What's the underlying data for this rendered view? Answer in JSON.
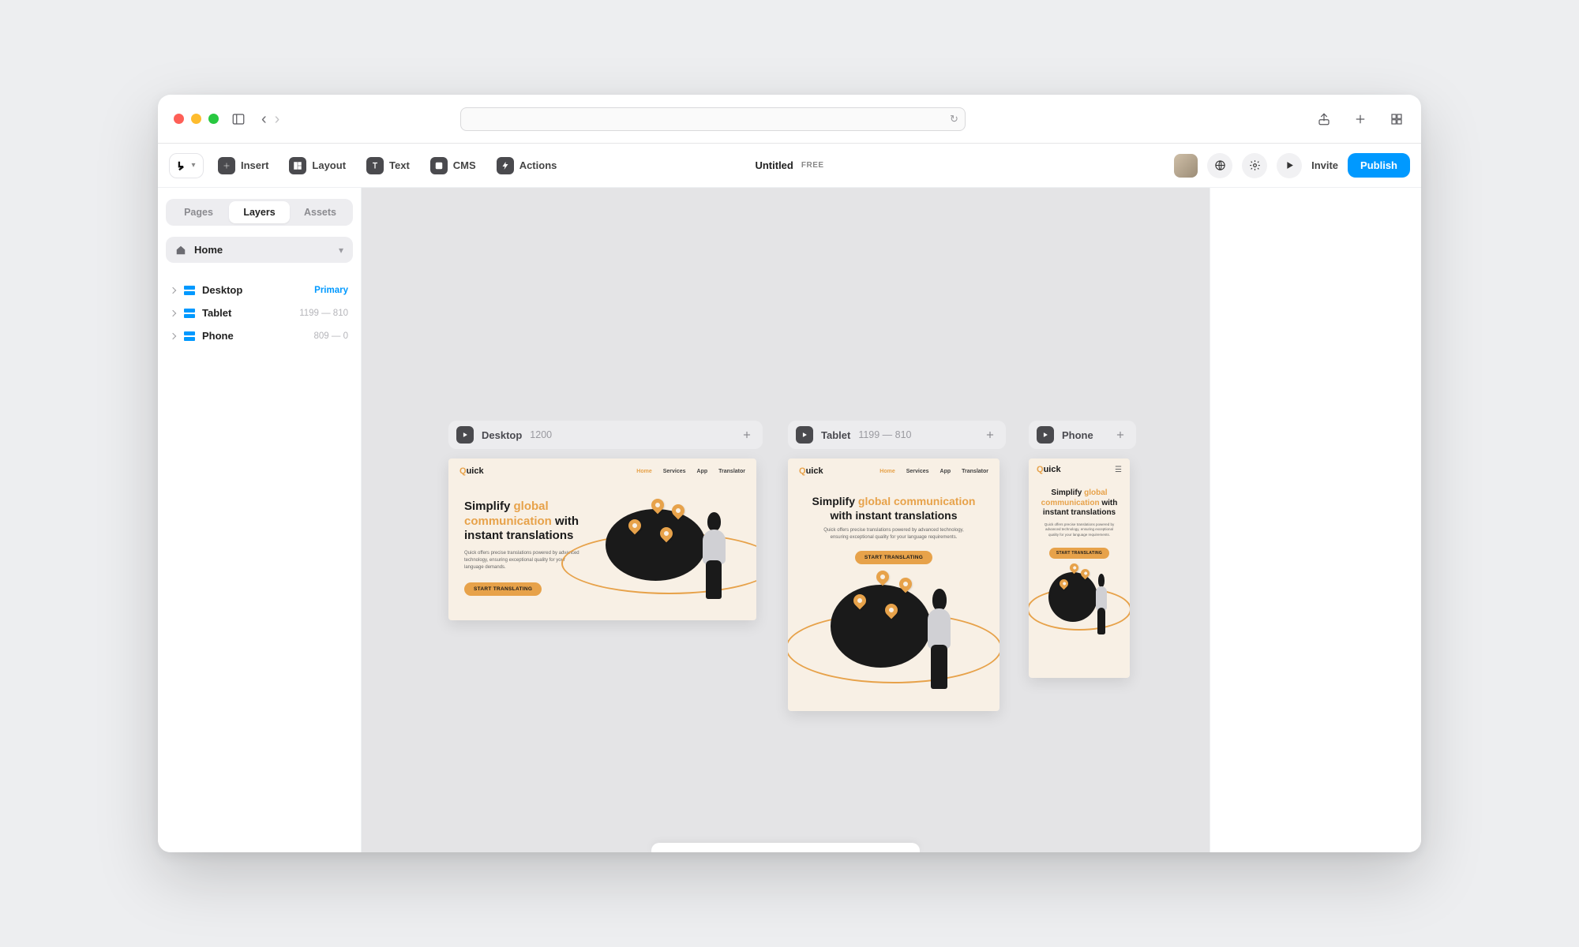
{
  "browser": {
    "url": ""
  },
  "toolbar": {
    "insert": "Insert",
    "layout": "Layout",
    "text": "Text",
    "cms": "CMS",
    "actions": "Actions"
  },
  "doc": {
    "title": "Untitled",
    "plan": "FREE"
  },
  "buttons": {
    "invite": "Invite",
    "publish": "Publish"
  },
  "sidebar": {
    "tabs": {
      "pages": "Pages",
      "layers": "Layers",
      "assets": "Assets"
    },
    "home": "Home",
    "layers": [
      {
        "name": "Desktop",
        "meta": "Primary",
        "primary": true
      },
      {
        "name": "Tablet",
        "meta": "1199 — 810"
      },
      {
        "name": "Phone",
        "meta": "809 — 0"
      }
    ]
  },
  "breakpoints": {
    "desktop": {
      "name": "Desktop",
      "dim": "1200"
    },
    "tablet": {
      "name": "Tablet",
      "dim": "1199 — 810"
    },
    "phone": {
      "name": "Phone",
      "dim": ""
    }
  },
  "mock": {
    "brand_pre": "Q",
    "brand_rest": "uick",
    "nav": {
      "home": "Home",
      "services": "Services",
      "app": "App",
      "translator": "Translator"
    },
    "h_pre": "Simplify ",
    "h_em": "global communication",
    "h_post": " with instant translations",
    "body_desktop": "Quick offers precise translations powered by advanced technology, ensuring exceptional quality for your language demands.",
    "body_wide": "Quick offers precise translations powered by advanced technology, ensuring exceptional quality for your language requirements.",
    "body_phone": "Quick offers precise translations powered by advanced technology, ensuring exceptional quality for your language requirements.",
    "cta": "START TRANSLATING"
  }
}
